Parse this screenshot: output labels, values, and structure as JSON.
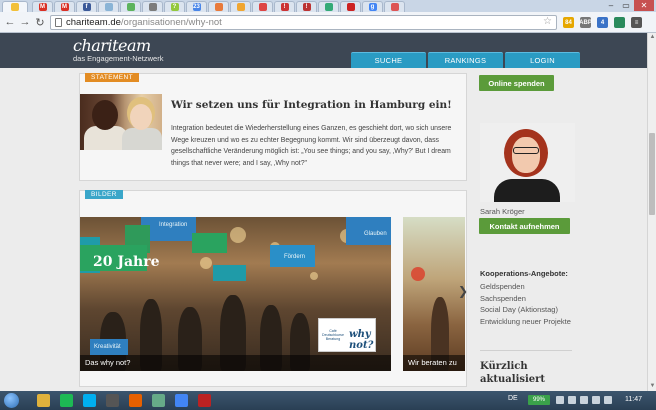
{
  "browser": {
    "tabs": [
      {
        "fav": "page-icon",
        "color": "#f2c03a",
        "glyph": "",
        "active": true
      },
      {
        "fav": "gmail-icon",
        "color": "#d93025",
        "glyph": "M"
      },
      {
        "fav": "gmail-icon",
        "color": "#d93025",
        "glyph": "M"
      },
      {
        "fav": "facebook-icon",
        "color": "#3b5998",
        "glyph": "f"
      },
      {
        "fav": "page-icon",
        "color": "#8ab4d6",
        "glyph": ""
      },
      {
        "fav": "page-icon",
        "color": "#5db35d",
        "glyph": ""
      },
      {
        "fav": "page-icon",
        "color": "#7c7c7c",
        "glyph": ""
      },
      {
        "fav": "page-icon",
        "color": "#94c83d",
        "glyph": "?"
      },
      {
        "fav": "calendar-icon",
        "color": "#4a86e8",
        "glyph": "23"
      },
      {
        "fav": "page-icon",
        "color": "#e87a3b",
        "glyph": ""
      },
      {
        "fav": "page-icon",
        "color": "#f0a630",
        "glyph": ""
      },
      {
        "fav": "page-icon",
        "color": "#d44",
        "glyph": ""
      },
      {
        "fav": "page-icon",
        "color": "#c33",
        "glyph": "!"
      },
      {
        "fav": "page-icon",
        "color": "#b33",
        "glyph": "!"
      },
      {
        "fav": "page-icon",
        "color": "#3a7",
        "glyph": ""
      },
      {
        "fav": "page-icon",
        "color": "#c22",
        "glyph": ""
      },
      {
        "fav": "google-icon",
        "color": "#4285f4",
        "glyph": "g"
      },
      {
        "fav": "page-icon",
        "color": "#d55",
        "glyph": ""
      }
    ],
    "url_host": "chariteam.de",
    "url_path": "/organisationen/why-not",
    "extensions": [
      {
        "color": "#e6a700",
        "glyph": "84"
      },
      {
        "color": "#777",
        "glyph": "ABP"
      },
      {
        "color": "#3b73c7",
        "glyph": "4"
      },
      {
        "color": "#2a8a5c",
        "glyph": ""
      },
      {
        "color": "#555",
        "glyph": "≡"
      }
    ]
  },
  "site": {
    "logo_main": "chariteam",
    "logo_sub": "das Engagement-Netzwerk",
    "nav": [
      "SUCHE",
      "RANKINGS",
      "LOGIN"
    ]
  },
  "statement": {
    "tag": "STATEMENT",
    "title": "Wir setzen uns für Integration in Hamburg ein!",
    "text": "Integration bedeutet die Wiederherstellung eines Ganzen, es geschieht dort, wo sich unsere Wege kreuzen und wo es zu echter Begegnung kommt. Wir sind überzeugt davon, dass gesellschaftliche Veränderung möglich ist: „You see things; and you say, ‚Why?' But I dream things that never were; and I say, ‚Why not?\""
  },
  "gallery": {
    "tag": "BILDER",
    "hero_title": "20 Jahre",
    "tile_labels": [
      "Integration",
      "Glauben",
      "Fördern",
      "Kreativität"
    ],
    "cafe_label": "Café\nDeutschkurse\nBeratung",
    "whynot_label": "why not?",
    "caption1": "Das why not?",
    "caption2": "Wir beraten zu"
  },
  "sidebar": {
    "donate": "Online spenden",
    "person_name": "Sarah Kröger",
    "contact": "Kontakt aufnehmen",
    "coop_heading": "Kooperations-Angebote:",
    "coop_items": [
      "Geldspenden",
      "Sachspenden",
      "Social Day (Aktionstag)",
      "Entwicklung neuer Projekte"
    ],
    "recent_heading": "Kürzlich aktualisiert"
  },
  "taskbar": {
    "lang": "DE",
    "battery": "99%",
    "time": "11:47",
    "apps": [
      {
        "name": "windows-explorer-icon",
        "color": "#e0b23c"
      },
      {
        "name": "spotify-icon",
        "color": "#1db954"
      },
      {
        "name": "skype-icon",
        "color": "#00aff0"
      },
      {
        "name": "app-icon",
        "color": "#555"
      },
      {
        "name": "firefox-icon",
        "color": "#e66000"
      },
      {
        "name": "app-icon",
        "color": "#6a8"
      },
      {
        "name": "chrome-icon",
        "color": "#4285f4"
      },
      {
        "name": "filezilla-icon",
        "color": "#b22"
      }
    ]
  }
}
